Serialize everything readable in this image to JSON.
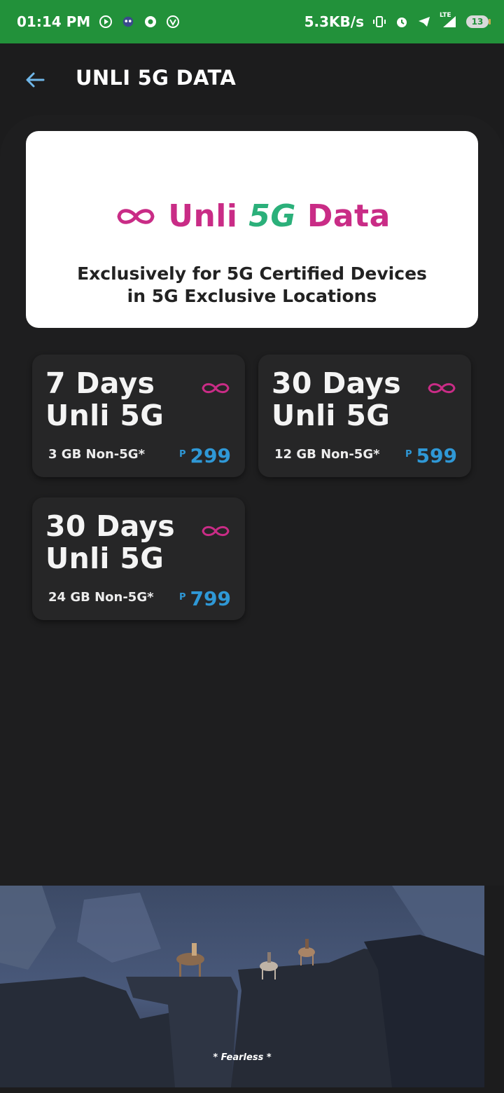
{
  "status_bar": {
    "time": "01:14 PM",
    "net_speed": "5.3KB/s",
    "network": "LTE",
    "battery": "13"
  },
  "header": {
    "title": "UNLI 5G DATA"
  },
  "banner": {
    "logo_prefix": "Unli ",
    "logo_5g": "5G",
    "logo_suffix": " Data",
    "tagline_line1": "Exclusively for 5G Certified Devices",
    "tagline_line2": "in 5G Exclusive Locations"
  },
  "plans": [
    {
      "title_line1": "7 Days",
      "title_line2": "Unli 5G",
      "quota": "3 GB Non-5G*",
      "currency": "P",
      "price": "299"
    },
    {
      "title_line1": "30 Days",
      "title_line2": "Unli 5G",
      "quota": "12 GB Non-5G*",
      "currency": "P",
      "price": "599"
    },
    {
      "title_line1": "30 Days",
      "title_line2": "Unli 5G",
      "quota": "24 GB Non-5G*",
      "currency": "P",
      "price": "799"
    }
  ],
  "ad": {
    "caption": "* Fearless *"
  },
  "colors": {
    "status_bar": "#22913a",
    "background": "#1c1c1d",
    "card": "#262627",
    "accent_magenta": "#c92c86",
    "accent_green": "#2bb07a",
    "price_blue": "#2f98d6",
    "back_arrow": "#6fb6e8"
  },
  "icons": {
    "back": "arrow-left-icon",
    "plan": "infinity-icon"
  }
}
